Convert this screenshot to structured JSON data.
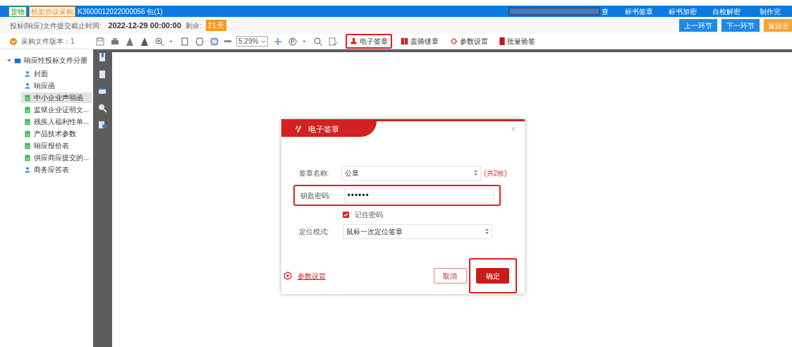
{
  "header": {
    "tags": [
      {
        "label": "货物",
        "color": "#2e9e4f"
      },
      {
        "label": "框架协议采购",
        "color": "#f08a24"
      }
    ],
    "project": "K3600012022000056 包(1)",
    "menu": [
      {
        "label": "查"
      },
      {
        "label": "标书签章"
      },
      {
        "label": "标书加密"
      },
      {
        "label": "自检解密"
      },
      {
        "label": "制作完"
      }
    ]
  },
  "deadline": {
    "label": "投标(响应)文件提交截止时间:",
    "value": "2022-12-29 00:00:00",
    "remain_label": "剩余:",
    "remain": "21天"
  },
  "nav_buttons": [
    {
      "label": "上一环节",
      "kind": "blue"
    },
    {
      "label": "下一环节",
      "kind": "blue"
    },
    {
      "label": "返回主",
      "kind": "orange"
    }
  ],
  "version": "采购文件版本：1",
  "toolbar": {
    "zoom": "5.29%",
    "actions": [
      {
        "label": "电子签章",
        "highlighted": true
      },
      {
        "label": "盖骑缝章",
        "highlighted": false
      },
      {
        "label": "参数设置",
        "highlighted": false
      },
      {
        "label": "批量验签",
        "highlighted": false
      }
    ]
  },
  "tree": {
    "label": "响应性投标文件分册",
    "expanded": true,
    "children": [
      {
        "label": "封面",
        "kind": "person",
        "selected": false
      },
      {
        "label": "响应函",
        "kind": "person",
        "selected": false
      },
      {
        "label": "中小企业声明函",
        "kind": "doc",
        "selected": true
      },
      {
        "label": "监狱企业证明文...",
        "kind": "doc",
        "selected": false
      },
      {
        "label": "残疾人福利性单...",
        "kind": "doc",
        "selected": false
      },
      {
        "label": "产品技术参数",
        "kind": "doc",
        "selected": false
      },
      {
        "label": "响应报价表",
        "kind": "doc",
        "selected": false
      },
      {
        "label": "供应商应提交的...",
        "kind": "doc",
        "selected": false
      },
      {
        "label": "商务应答表",
        "kind": "person",
        "selected": false
      }
    ]
  },
  "dialog": {
    "title": "电子签章",
    "close": "×",
    "seal_name": {
      "label": "签章名称:",
      "value": "公章",
      "count": "(共2枚)"
    },
    "password": {
      "label": "钥匙密码:",
      "value": "••••••",
      "highlighted": true
    },
    "remember": {
      "label": "记住密码",
      "checked": true
    },
    "mode": {
      "label": "定位模式:",
      "value": "鼠标一次定位签章"
    },
    "settings_link": "参数设置",
    "cancel": "取消",
    "confirm": {
      "label": "确定",
      "highlighted": true
    }
  }
}
